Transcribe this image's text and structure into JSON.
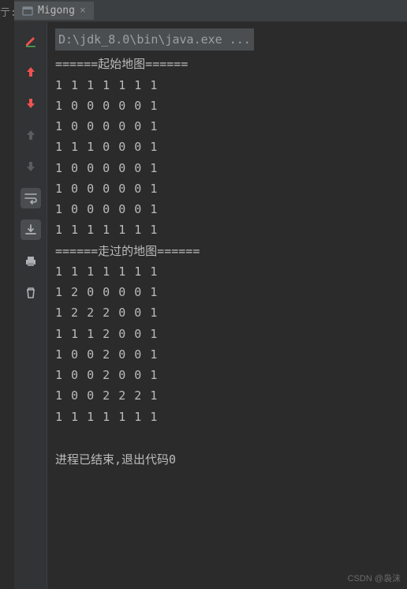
{
  "side_label": "亍:",
  "tab": {
    "label": "Migong",
    "close": "×"
  },
  "console": {
    "command": "D:\\jdk_8.0\\bin\\java.exe ...",
    "section1_header": "======起始地图======",
    "grid1": [
      "1 1 1 1 1 1 1",
      "1 0 0 0 0 0 1",
      "1 0 0 0 0 0 1",
      "1 1 1 0 0 0 1",
      "1 0 0 0 0 0 1",
      "1 0 0 0 0 0 1",
      "1 0 0 0 0 0 1",
      "1 1 1 1 1 1 1"
    ],
    "section2_header": "======走过的地图======",
    "grid2": [
      "1 1 1 1 1 1 1",
      "1 2 0 0 0 0 1",
      "1 2 2 2 0 0 1",
      "1 1 1 2 0 0 1",
      "1 0 0 2 0 0 1",
      "1 0 0 2 0 0 1",
      "1 0 0 2 2 2 1",
      "1 1 1 1 1 1 1"
    ],
    "exit_message": "进程已结束,退出代码0"
  },
  "watermark": "CSDN @袅沫",
  "colors": {
    "red": "#f0524f",
    "grey": "#6e6e6e",
    "icon": "#aeb1b3"
  }
}
